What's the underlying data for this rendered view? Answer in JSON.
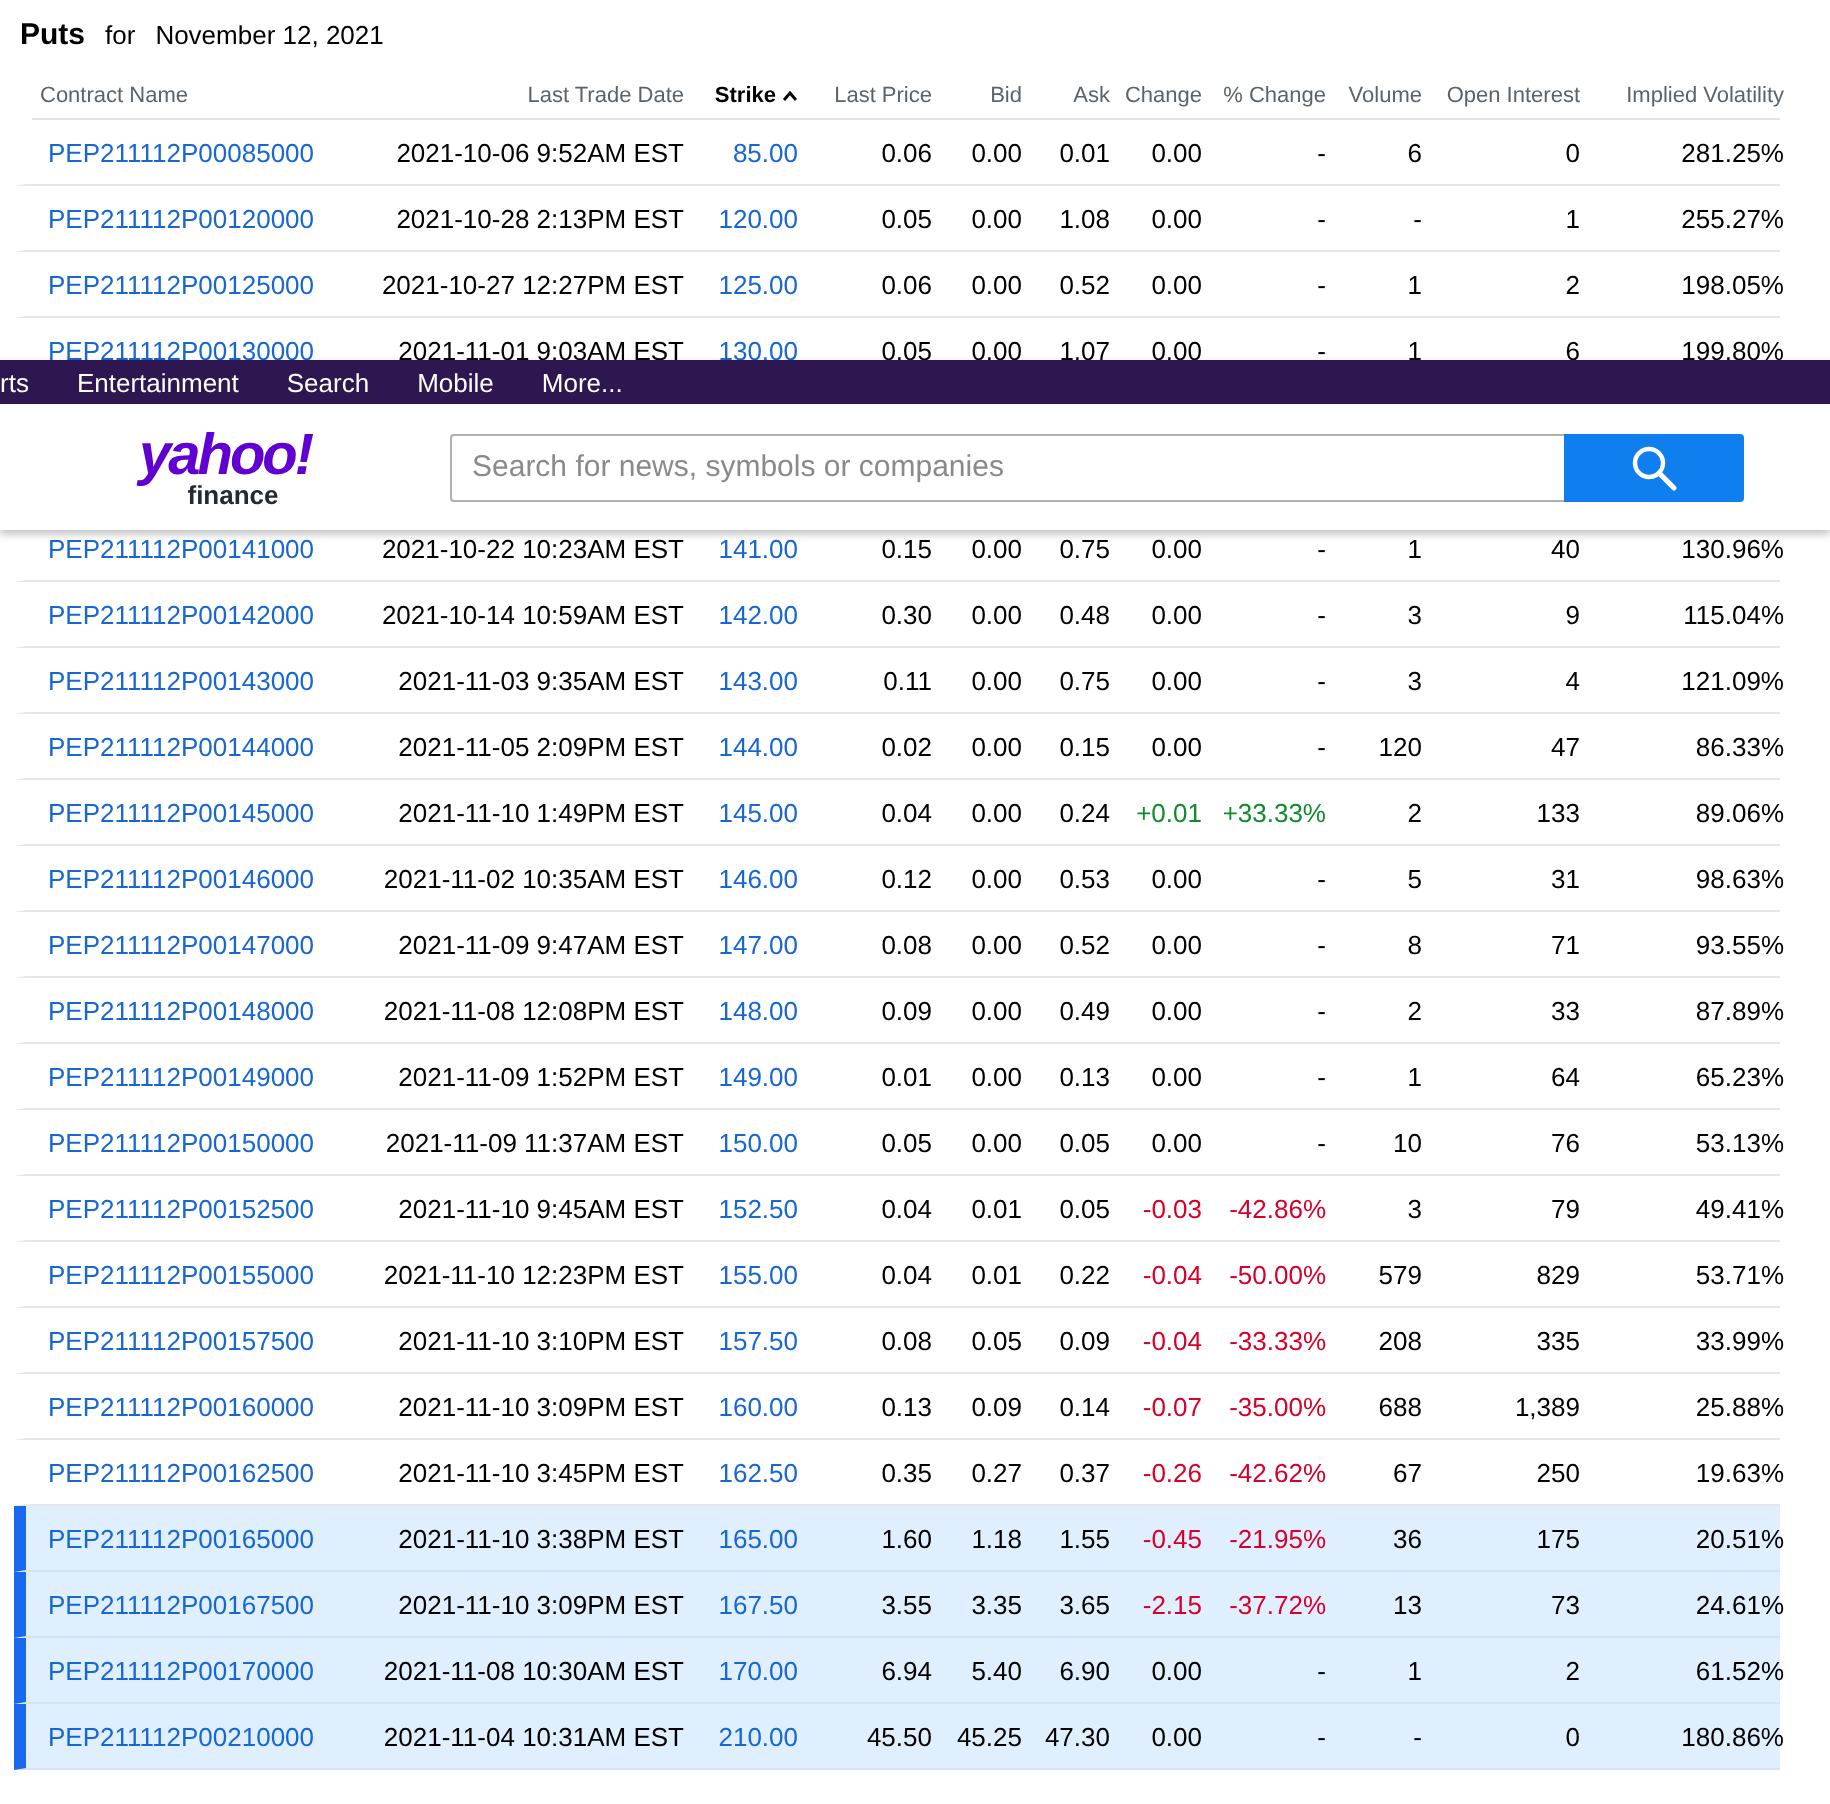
{
  "title": {
    "heading": "Puts",
    "connector": "for",
    "date": "November 12, 2021"
  },
  "columns": [
    {
      "label": "Contract Name",
      "sorted": false
    },
    {
      "label": "Last Trade Date",
      "sorted": false
    },
    {
      "label": "Strike",
      "sorted": true
    },
    {
      "label": "Last Price",
      "sorted": false
    },
    {
      "label": "Bid",
      "sorted": false
    },
    {
      "label": "Ask",
      "sorted": false
    },
    {
      "label": "Change",
      "sorted": false
    },
    {
      "label": "% Change",
      "sorted": false
    },
    {
      "label": "Volume",
      "sorted": false
    },
    {
      "label": "Open Interest",
      "sorted": false
    },
    {
      "label": "Implied Volatility",
      "sorted": false
    }
  ],
  "top_rows": [
    {
      "contract": "PEP211112P00085000",
      "date": "2021-10-06 9:52AM EST",
      "strike": "85.00",
      "last": "0.06",
      "bid": "0.00",
      "ask": "0.01",
      "change": "0.00",
      "pct": "-",
      "volume": "6",
      "oi": "0",
      "iv": "281.25%",
      "in_the_money": false
    },
    {
      "contract": "PEP211112P00120000",
      "date": "2021-10-28 2:13PM EST",
      "strike": "120.00",
      "last": "0.05",
      "bid": "0.00",
      "ask": "1.08",
      "change": "0.00",
      "pct": "-",
      "volume": "-",
      "oi": "1",
      "iv": "255.27%",
      "in_the_money": false
    },
    {
      "contract": "PEP211112P00125000",
      "date": "2021-10-27 12:27PM EST",
      "strike": "125.00",
      "last": "0.06",
      "bid": "0.00",
      "ask": "0.52",
      "change": "0.00",
      "pct": "-",
      "volume": "1",
      "oi": "2",
      "iv": "198.05%",
      "in_the_money": false
    },
    {
      "contract": "PEP211112P00130000",
      "date": "2021-11-01 9:03AM EST",
      "strike": "130.00",
      "last": "0.05",
      "bid": "0.00",
      "ask": "1.07",
      "change": "0.00",
      "pct": "-",
      "volume": "1",
      "oi": "6",
      "iv": "199.80%",
      "in_the_money": false
    }
  ],
  "header": {
    "nav": [
      "rts",
      "Entertainment",
      "Search",
      "Mobile",
      "More..."
    ],
    "logo": {
      "brand": "yahoo!",
      "product": "finance"
    },
    "search": {
      "placeholder": "Search for news, symbols or companies"
    }
  },
  "rows": [
    {
      "contract": "PEP211112P00141000",
      "date": "2021-10-22 10:23AM EST",
      "strike": "141.00",
      "last": "0.15",
      "bid": "0.00",
      "ask": "0.75",
      "change": "0.00",
      "pct": "-",
      "kind": "flat",
      "volume": "1",
      "oi": "40",
      "iv": "130.96%",
      "in_the_money": false
    },
    {
      "contract": "PEP211112P00142000",
      "date": "2021-10-14 10:59AM EST",
      "strike": "142.00",
      "last": "0.30",
      "bid": "0.00",
      "ask": "0.48",
      "change": "0.00",
      "pct": "-",
      "kind": "flat",
      "volume": "3",
      "oi": "9",
      "iv": "115.04%",
      "in_the_money": false
    },
    {
      "contract": "PEP211112P00143000",
      "date": "2021-11-03 9:35AM EST",
      "strike": "143.00",
      "last": "0.11",
      "bid": "0.00",
      "ask": "0.75",
      "change": "0.00",
      "pct": "-",
      "kind": "flat",
      "volume": "3",
      "oi": "4",
      "iv": "121.09%",
      "in_the_money": false
    },
    {
      "contract": "PEP211112P00144000",
      "date": "2021-11-05 2:09PM EST",
      "strike": "144.00",
      "last": "0.02",
      "bid": "0.00",
      "ask": "0.15",
      "change": "0.00",
      "pct": "-",
      "kind": "flat",
      "volume": "120",
      "oi": "47",
      "iv": "86.33%",
      "in_the_money": false
    },
    {
      "contract": "PEP211112P00145000",
      "date": "2021-11-10 1:49PM EST",
      "strike": "145.00",
      "last": "0.04",
      "bid": "0.00",
      "ask": "0.24",
      "change": "+0.01",
      "pct": "+33.33%",
      "kind": "up",
      "volume": "2",
      "oi": "133",
      "iv": "89.06%",
      "in_the_money": false
    },
    {
      "contract": "PEP211112P00146000",
      "date": "2021-11-02 10:35AM EST",
      "strike": "146.00",
      "last": "0.12",
      "bid": "0.00",
      "ask": "0.53",
      "change": "0.00",
      "pct": "-",
      "kind": "flat",
      "volume": "5",
      "oi": "31",
      "iv": "98.63%",
      "in_the_money": false
    },
    {
      "contract": "PEP211112P00147000",
      "date": "2021-11-09 9:47AM EST",
      "strike": "147.00",
      "last": "0.08",
      "bid": "0.00",
      "ask": "0.52",
      "change": "0.00",
      "pct": "-",
      "kind": "flat",
      "volume": "8",
      "oi": "71",
      "iv": "93.55%",
      "in_the_money": false
    },
    {
      "contract": "PEP211112P00148000",
      "date": "2021-11-08 12:08PM EST",
      "strike": "148.00",
      "last": "0.09",
      "bid": "0.00",
      "ask": "0.49",
      "change": "0.00",
      "pct": "-",
      "kind": "flat",
      "volume": "2",
      "oi": "33",
      "iv": "87.89%",
      "in_the_money": false
    },
    {
      "contract": "PEP211112P00149000",
      "date": "2021-11-09 1:52PM EST",
      "strike": "149.00",
      "last": "0.01",
      "bid": "0.00",
      "ask": "0.13",
      "change": "0.00",
      "pct": "-",
      "kind": "flat",
      "volume": "1",
      "oi": "64",
      "iv": "65.23%",
      "in_the_money": false
    },
    {
      "contract": "PEP211112P00150000",
      "date": "2021-11-09 11:37AM EST",
      "strike": "150.00",
      "last": "0.05",
      "bid": "0.00",
      "ask": "0.05",
      "change": "0.00",
      "pct": "-",
      "kind": "flat",
      "volume": "10",
      "oi": "76",
      "iv": "53.13%",
      "in_the_money": false
    },
    {
      "contract": "PEP211112P00152500",
      "date": "2021-11-10 9:45AM EST",
      "strike": "152.50",
      "last": "0.04",
      "bid": "0.01",
      "ask": "0.05",
      "change": "-0.03",
      "pct": "-42.86%",
      "kind": "down",
      "volume": "3",
      "oi": "79",
      "iv": "49.41%",
      "in_the_money": false
    },
    {
      "contract": "PEP211112P00155000",
      "date": "2021-11-10 12:23PM EST",
      "strike": "155.00",
      "last": "0.04",
      "bid": "0.01",
      "ask": "0.22",
      "change": "-0.04",
      "pct": "-50.00%",
      "kind": "down",
      "volume": "579",
      "oi": "829",
      "iv": "53.71%",
      "in_the_money": false
    },
    {
      "contract": "PEP211112P00157500",
      "date": "2021-11-10 3:10PM EST",
      "strike": "157.50",
      "last": "0.08",
      "bid": "0.05",
      "ask": "0.09",
      "change": "-0.04",
      "pct": "-33.33%",
      "kind": "down",
      "volume": "208",
      "oi": "335",
      "iv": "33.99%",
      "in_the_money": false
    },
    {
      "contract": "PEP211112P00160000",
      "date": "2021-11-10 3:09PM EST",
      "strike": "160.00",
      "last": "0.13",
      "bid": "0.09",
      "ask": "0.14",
      "change": "-0.07",
      "pct": "-35.00%",
      "kind": "down",
      "volume": "688",
      "oi": "1,389",
      "iv": "25.88%",
      "in_the_money": false
    },
    {
      "contract": "PEP211112P00162500",
      "date": "2021-11-10 3:45PM EST",
      "strike": "162.50",
      "last": "0.35",
      "bid": "0.27",
      "ask": "0.37",
      "change": "-0.26",
      "pct": "-42.62%",
      "kind": "down",
      "volume": "67",
      "oi": "250",
      "iv": "19.63%",
      "in_the_money": false
    },
    {
      "contract": "PEP211112P00165000",
      "date": "2021-11-10 3:38PM EST",
      "strike": "165.00",
      "last": "1.60",
      "bid": "1.18",
      "ask": "1.55",
      "change": "-0.45",
      "pct": "-21.95%",
      "kind": "down",
      "volume": "36",
      "oi": "175",
      "iv": "20.51%",
      "in_the_money": true
    },
    {
      "contract": "PEP211112P00167500",
      "date": "2021-11-10 3:09PM EST",
      "strike": "167.50",
      "last": "3.55",
      "bid": "3.35",
      "ask": "3.65",
      "change": "-2.15",
      "pct": "-37.72%",
      "kind": "down",
      "volume": "13",
      "oi": "73",
      "iv": "24.61%",
      "in_the_money": true
    },
    {
      "contract": "PEP211112P00170000",
      "date": "2021-11-08 10:30AM EST",
      "strike": "170.00",
      "last": "6.94",
      "bid": "5.40",
      "ask": "6.90",
      "change": "0.00",
      "pct": "-",
      "kind": "flat",
      "volume": "1",
      "oi": "2",
      "iv": "61.52%",
      "in_the_money": true
    },
    {
      "contract": "PEP211112P00210000",
      "date": "2021-11-04 10:31AM EST",
      "strike": "210.00",
      "last": "45.50",
      "bid": "45.25",
      "ask": "47.30",
      "change": "0.00",
      "pct": "-",
      "kind": "flat",
      "volume": "-",
      "oi": "0",
      "iv": "180.86%",
      "in_the_money": true
    }
  ]
}
